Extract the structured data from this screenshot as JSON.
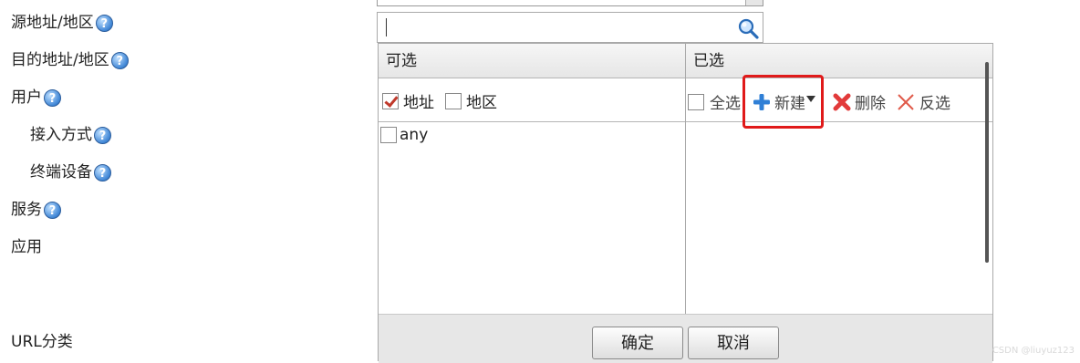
{
  "fields": {
    "source": "源地址/地区",
    "dest": "目的地址/地区",
    "user": "用户",
    "access": "接入方式",
    "terminal": "终端设备",
    "service": "服务",
    "app": "应用",
    "url": "URL分类"
  },
  "help_glyph": "?",
  "search": {
    "value": "",
    "icon": "magnifier-icon"
  },
  "panel": {
    "available_header": "可选",
    "selected_header": "已选",
    "filters": [
      {
        "label": "地址",
        "checked": true
      },
      {
        "label": "地区",
        "checked": false
      }
    ],
    "toolbar": {
      "select_all": "全选",
      "new": "新建",
      "delete": "删除",
      "invert": "反选"
    },
    "available_items": [
      {
        "label": "any",
        "checked": false
      }
    ]
  },
  "buttons": {
    "ok": "确定",
    "cancel": "取消"
  },
  "watermark": "CSDN @liuyuz123",
  "colors": {
    "highlight": "#e01a1a",
    "check": "#c0392b",
    "plus": "#2f7fd6"
  }
}
